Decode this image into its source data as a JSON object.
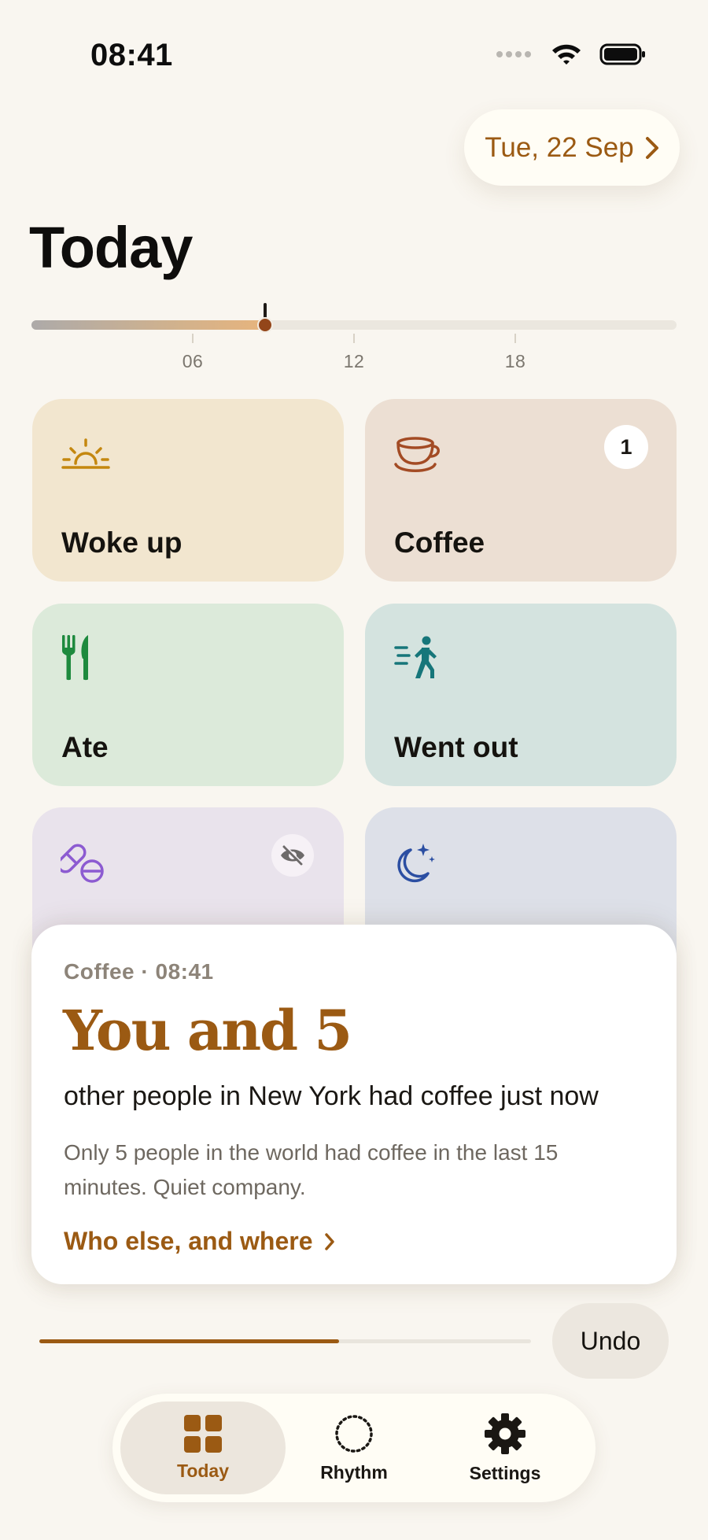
{
  "status_bar": {
    "time": "08:41"
  },
  "header": {
    "date_label": "Tue, 22 Sep",
    "page_title": "Today"
  },
  "timeline": {
    "hour_labels": [
      "06",
      "12",
      "18"
    ],
    "current_time": "08:41",
    "progress_fraction": 0.362
  },
  "tiles": [
    {
      "label": "Woke up",
      "icon": "sunrise-icon",
      "color": "#f2e6cf"
    },
    {
      "label": "Coffee",
      "icon": "coffee-cup-icon",
      "badge": "1",
      "color": "#ecdfd3"
    },
    {
      "label": "Ate",
      "icon": "fork-knife-icon",
      "color": "#dceada"
    },
    {
      "label": "Went out",
      "icon": "walking-person-icon",
      "color": "#d4e3df"
    },
    {
      "label": "",
      "icon": "pills-icon",
      "color": "#e9e3ec"
    },
    {
      "label": "",
      "icon": "moon-stars-icon",
      "color": "#dde0e8"
    }
  ],
  "popup": {
    "meta": "Coffee · 08:41",
    "headline": "You and 5",
    "subtitle": "other people in New York had coffee just now",
    "body": "Only 5 people in the world had coffee in the last 15 minutes. Quiet company.",
    "link_label": "Who else, and where"
  },
  "undo": {
    "label": "Undo",
    "progress_fraction": 0.61
  },
  "tab_bar": {
    "tabs": [
      {
        "label": "Today",
        "icon": "grid-icon",
        "active": true
      },
      {
        "label": "Rhythm",
        "icon": "dotted-circle-icon",
        "active": false
      },
      {
        "label": "Settings",
        "icon": "gear-icon",
        "active": false
      }
    ]
  },
  "colors": {
    "accent": "#9b5a13",
    "background": "#f9f6f0"
  }
}
